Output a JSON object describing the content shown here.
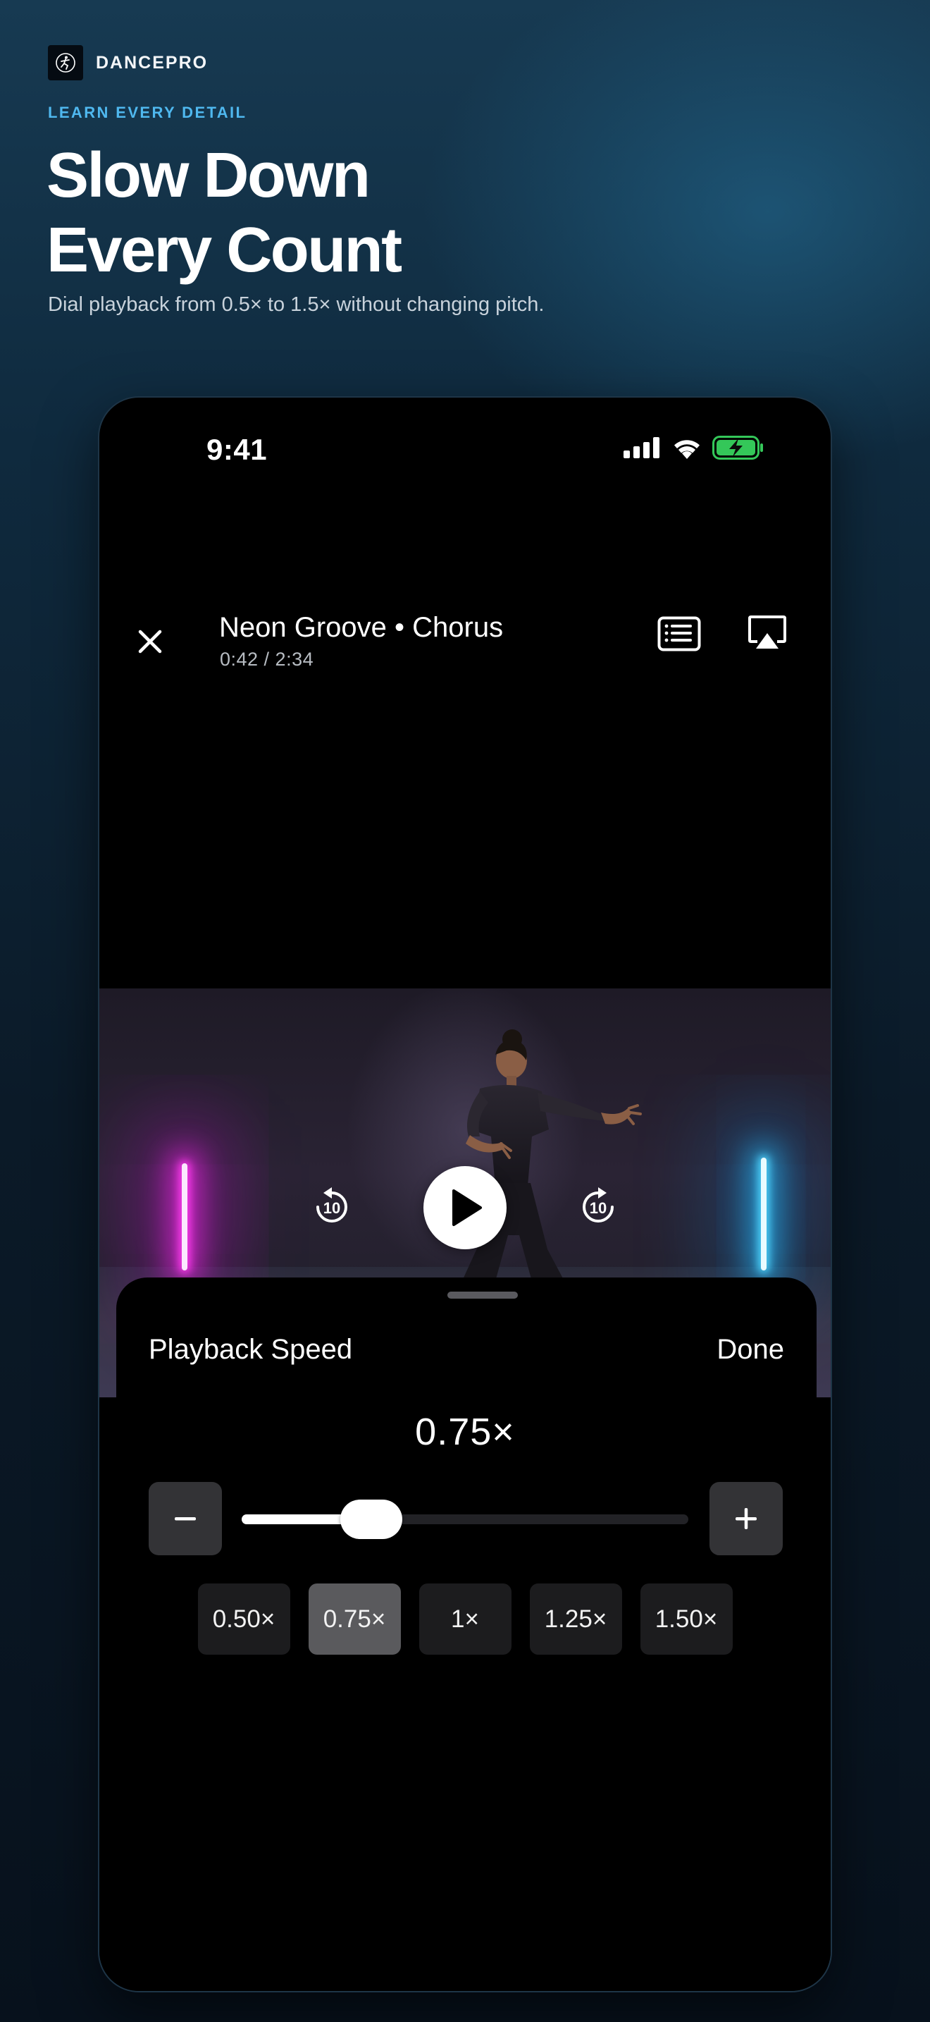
{
  "brand": {
    "name": "DANCEPRO",
    "logo_icon": "dancer-logo-icon"
  },
  "hero": {
    "eyebrow": "LEARN EVERY DETAIL",
    "headline_line1": "Slow Down",
    "headline_line2": "Every Count",
    "subline": "Dial playback from 0.5× to 1.5× without changing pitch."
  },
  "status_bar": {
    "time": "9:41",
    "icons": [
      "cellular-signal-icon",
      "wifi-icon",
      "battery-charging-icon"
    ],
    "battery_color": "#34c759"
  },
  "player": {
    "title": "Neon Groove • Chorus",
    "time": "0:42 / 2:34",
    "icons": [
      "close-icon",
      "chapters-icon",
      "airplay-icon",
      "skip-back-10-icon",
      "play-icon",
      "skip-forward-10-icon"
    ],
    "skip_back_label": "10",
    "skip_forward_label": "10"
  },
  "speed_sheet": {
    "title": "Playback Speed",
    "done_label": "Done",
    "current_value": "0.75×",
    "slider_fraction": 0.29,
    "presets": [
      {
        "label": "0.50×",
        "selected": false
      },
      {
        "label": "0.75×",
        "selected": true
      },
      {
        "label": "1×",
        "selected": false
      },
      {
        "label": "1.25×",
        "selected": false
      },
      {
        "label": "1.50×",
        "selected": false
      }
    ]
  },
  "colors": {
    "accent": "#4fb8ef",
    "neon_left": "#ff3cf0",
    "neon_right": "#4fd6ff"
  }
}
